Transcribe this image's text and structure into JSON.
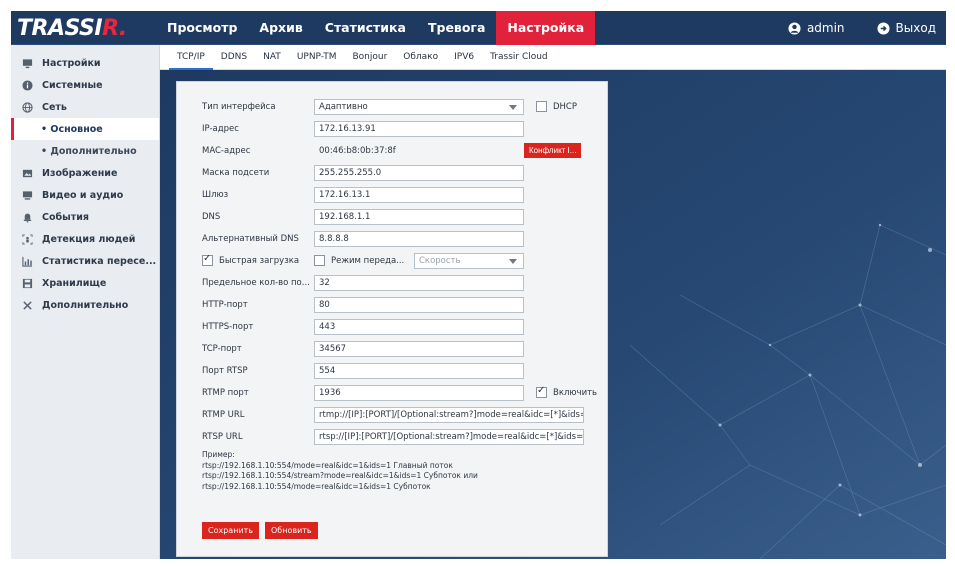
{
  "logo": {
    "main": "TRASSI",
    "accent": "R."
  },
  "nav": [
    "Просмотр",
    "Архив",
    "Статистика",
    "Тревога",
    "Настройка"
  ],
  "nav_active": "Настройка",
  "user": {
    "name": "admin",
    "logout": "Выход"
  },
  "sidebar": {
    "items": [
      {
        "label": "Настройки",
        "icon": "monitor-icon"
      },
      {
        "label": "Системные",
        "icon": "info-icon"
      },
      {
        "label": "Сеть",
        "icon": "globe-icon"
      },
      {
        "label": "• Основное",
        "sub": true,
        "active": true
      },
      {
        "label": "• Дополнительно",
        "sub": true
      },
      {
        "label": "Изображение",
        "icon": "image-icon"
      },
      {
        "label": "Видео и аудио",
        "icon": "video-icon"
      },
      {
        "label": "События",
        "icon": "bell-icon"
      },
      {
        "label": "Детекция людей",
        "icon": "person-detect-icon"
      },
      {
        "label": "Статистика пересе...",
        "icon": "chart-icon"
      },
      {
        "label": "Хранилище",
        "icon": "save-icon"
      },
      {
        "label": "Дополнительно",
        "icon": "tools-icon"
      }
    ]
  },
  "tabs": [
    "TCP/IP",
    "DDNS",
    "NAT",
    "UPNP-TM",
    "Bonjour",
    "Облако",
    "IPV6",
    "Trassir Cloud"
  ],
  "tab_active": "TCP/IP",
  "form": {
    "interface_type": {
      "label": "Тип интерфейса",
      "value": "Адаптивно"
    },
    "dhcp": {
      "label": "DHCP",
      "checked": false
    },
    "ip": {
      "label": "IP-адрес",
      "value": "172.16.13.91"
    },
    "mac": {
      "label": "MAC-адрес",
      "value": "00:46:b8:0b:37:8f"
    },
    "conflict_button": "Конфликт I...",
    "mask": {
      "label": "Маска подсети",
      "value": "255.255.255.0"
    },
    "gateway": {
      "label": "Шлюз",
      "value": "172.16.13.1"
    },
    "dns": {
      "label": "DNS",
      "value": "192.168.1.1"
    },
    "alt_dns": {
      "label": "Альтернативный DNS",
      "value": "8.8.8.8"
    },
    "fast_boot": {
      "label": "Быстрая загрузка",
      "checked": true
    },
    "transfer_mode": {
      "label": "Режим переда...",
      "checked": false,
      "placeholder": "Скорость"
    },
    "max_count": {
      "label": "Предельное кол-во по...",
      "value": "32"
    },
    "http_port": {
      "label": "HTTP-порт",
      "value": "80"
    },
    "https_port": {
      "label": "HTTPS-порт",
      "value": "443"
    },
    "tcp_port": {
      "label": "TCP-порт",
      "value": "34567"
    },
    "rtsp_port": {
      "label": "Порт RTSP",
      "value": "554"
    },
    "rtmp_port": {
      "label": "RTMP порт",
      "value": "1936"
    },
    "rtmp_enable": {
      "label": "Включить",
      "checked": true
    },
    "rtmp_url": {
      "label": "RTMP URL",
      "value": "rtmp://[IP]:[PORT]/[Optional:stream?]mode=real&idc=[*]&ids=[*]"
    },
    "rtsp_url": {
      "label": "RTSP URL",
      "value": "rtsp://[IP]:[PORT]/[Optional:stream?]mode=real&idc=[*]&ids=[*]"
    }
  },
  "example": {
    "title": "Пример:",
    "line1": "rtsp://192.168.1.10:554/mode=real&idc=1&ids=1 Главный поток",
    "line2": "rtsp://192.168.1.10:554/stream?mode=real&idc=1&ids=1 Субпоток или",
    "line3": "rtsp://192.168.1.10:554/mode=real&idc=1&ids=1 Субпоток"
  },
  "buttons": {
    "save": "Сохранить",
    "refresh": "Обновить"
  },
  "colors": {
    "header": "#1f3a60",
    "accent": "#e2213a",
    "main_bg": "#22406b",
    "button": "#d9251d"
  }
}
